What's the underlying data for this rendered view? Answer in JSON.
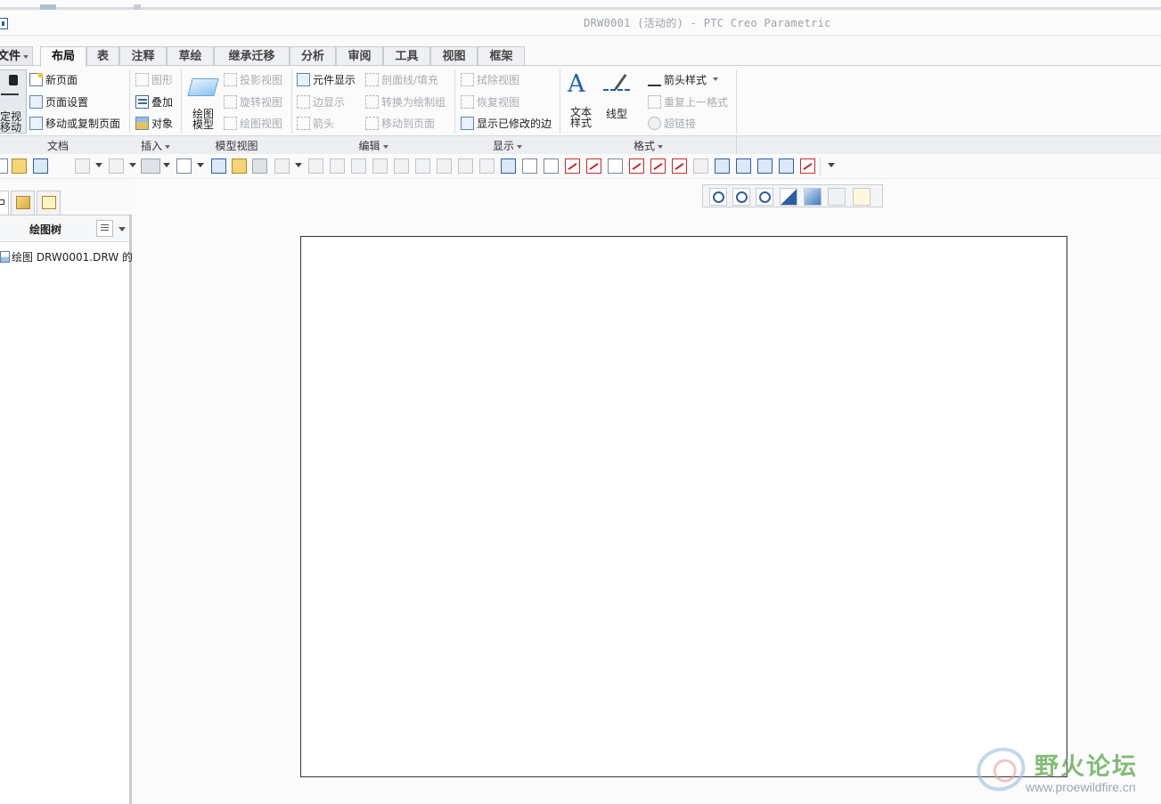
{
  "window": {
    "title": "DRW0001 (活动的) - PTC Creo Parametric"
  },
  "ribbon": {
    "tabs": [
      {
        "label": "文件",
        "active": false
      },
      {
        "label": "布局",
        "active": true
      },
      {
        "label": "表",
        "active": false
      },
      {
        "label": "注释",
        "active": false
      },
      {
        "label": "草绘",
        "active": false
      },
      {
        "label": "继承迁移",
        "active": false
      },
      {
        "label": "分析",
        "active": false
      },
      {
        "label": "审阅",
        "active": false
      },
      {
        "label": "工具",
        "active": false
      },
      {
        "label": "视图",
        "active": false
      },
      {
        "label": "框架",
        "active": false
      }
    ],
    "groups": {
      "document": {
        "label": "文档",
        "lock_view_move": {
          "line1": "定视",
          "line2": "移动"
        },
        "new_page": "新页面",
        "page_setup": "页面设置",
        "move_copy_page": "移动或复制页面"
      },
      "insert": {
        "label": "插入",
        "graphic": "图形",
        "overlay": "叠加",
        "object": "对象"
      },
      "model_views": {
        "label": "模型视图",
        "drawing_model": {
          "line1": "绘图",
          "line2": "模型"
        },
        "projection_view": "投影视图",
        "revolved_view": "旋转视图",
        "drawing_view": "绘图视图"
      },
      "edit": {
        "label": "编辑",
        "component_display": "元件显示",
        "edge_display": "边显示",
        "arrow": "箭头",
        "hatching_fill": "剖面线/填充",
        "convert_to_draft_group": "转换为绘制组",
        "move_to_page": "移动到页面"
      },
      "display": {
        "label": "显示",
        "erase_view": "拭除视图",
        "resume_view": "恢复视图",
        "show_modified_edges": "显示已修改的边"
      },
      "format": {
        "label": "格式",
        "text_style": {
          "line1": "文本",
          "line2": "样式"
        },
        "line_style": "线型",
        "arrow_style": "箭头样式",
        "repeat_last_format": "重复上一格式",
        "hyperlink": "超链接"
      }
    }
  },
  "navigator": {
    "title": "绘图树",
    "tree_items": [
      "绘图 DRW0001.DRW 的"
    ]
  },
  "watermark": {
    "site_name": "野火论坛",
    "url": "www.proewildfire.cn"
  },
  "colors": {
    "accent_blue": "#2e5fa6",
    "sheet_border": "#333333",
    "watermark_green": "#6eaf5f"
  }
}
